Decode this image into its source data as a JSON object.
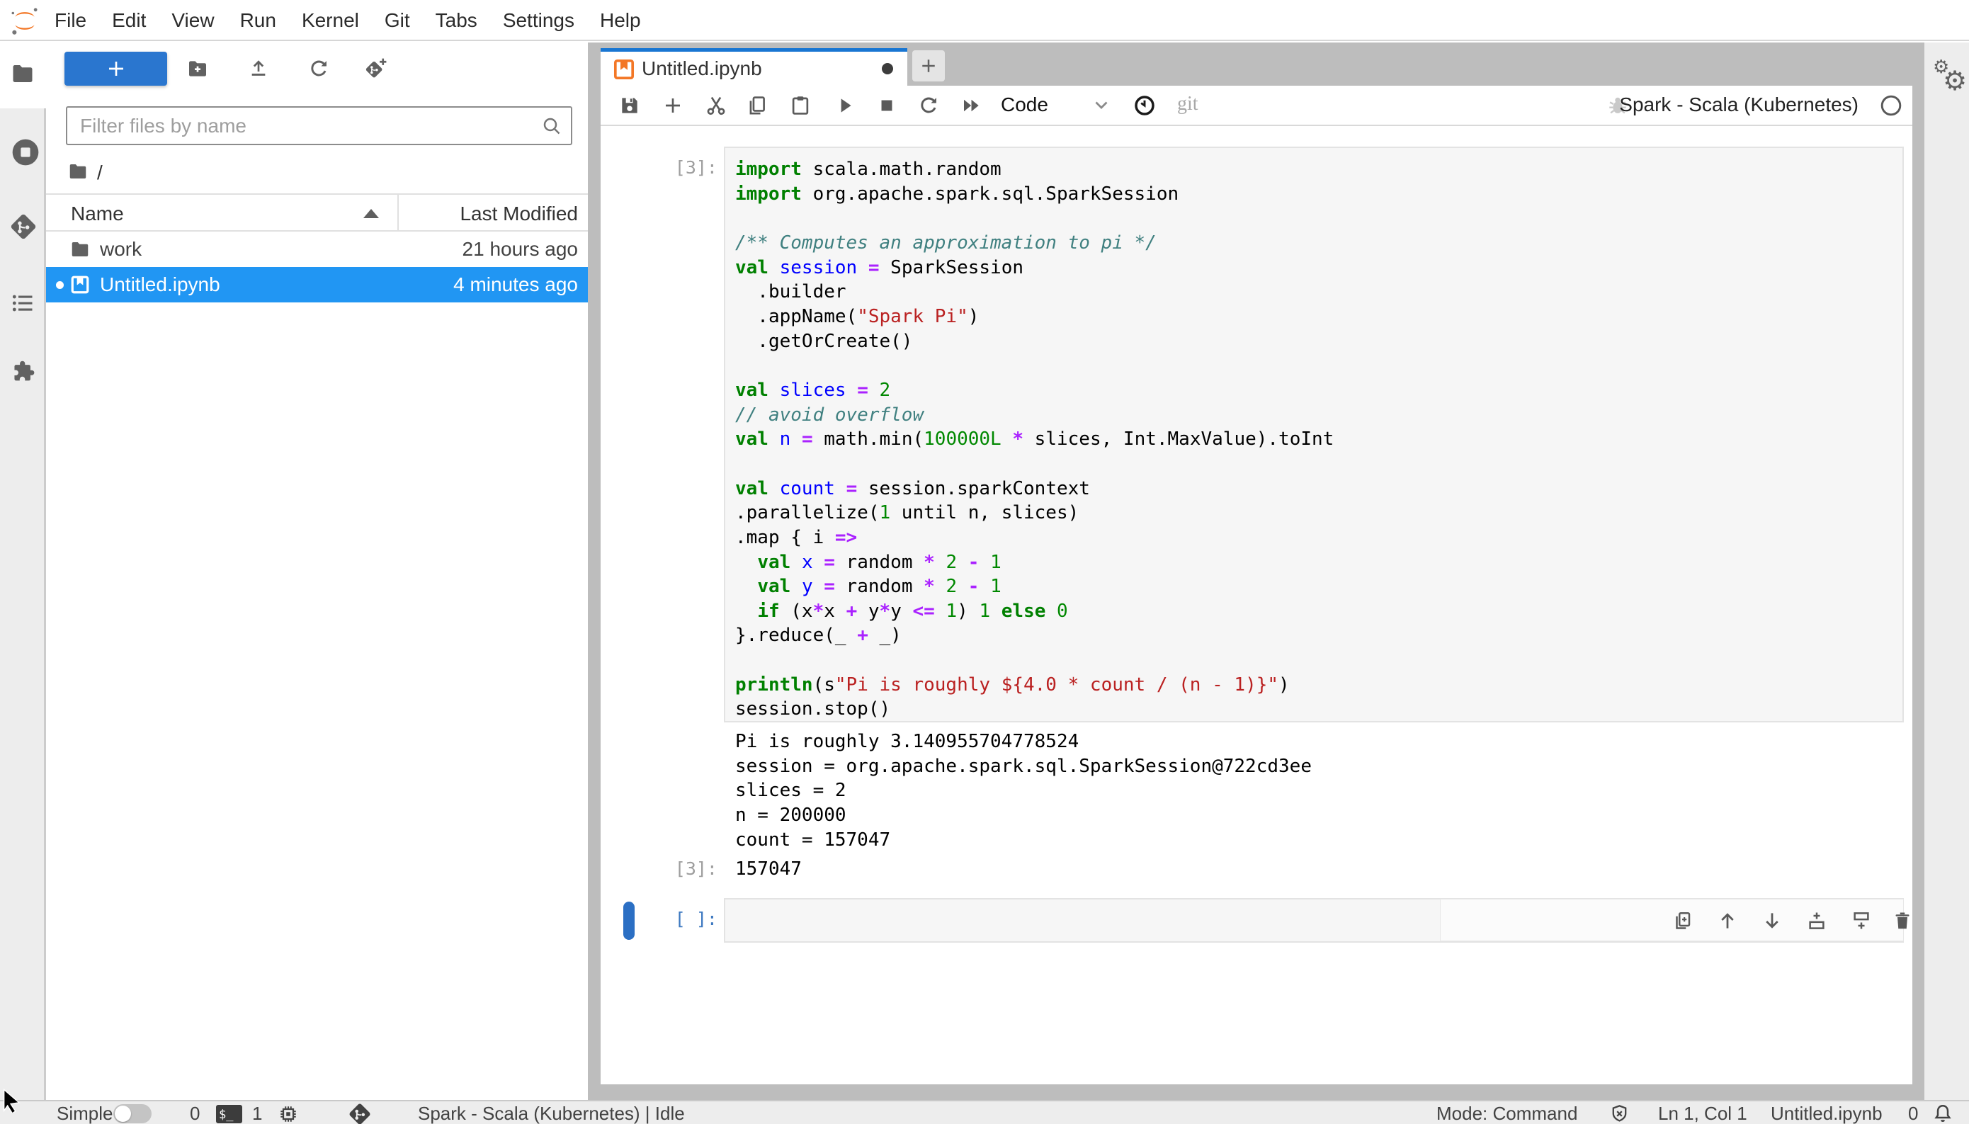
{
  "colors": {
    "accent": "#1976d2",
    "selection": "#2196f3",
    "launcher_button": "#2a76cf",
    "collapser": "#2b6fc4",
    "active_prompt": "#3d78c0",
    "keyword": "#008000",
    "definition": "#0000ff",
    "operator": "#AA22FF",
    "number": "#008800",
    "string": "#BA2121",
    "comment": "#408080",
    "brand_orange": "#F37726"
  },
  "menu": {
    "items": [
      "File",
      "Edit",
      "View",
      "Run",
      "Kernel",
      "Git",
      "Tabs",
      "Settings",
      "Help"
    ]
  },
  "left_sidebar": {
    "icons": [
      "folder-icon",
      "running-kernels-icon",
      "git-icon",
      "table-of-contents-icon",
      "extensions-icon"
    ]
  },
  "file_browser": {
    "new_launcher_label": "+",
    "toolbar_icons": [
      "new-folder-icon",
      "upload-icon",
      "refresh-icon",
      "git-clone-icon"
    ],
    "filter_placeholder": "Filter files by name",
    "breadcrumb_root": "/",
    "columns": {
      "name": "Name",
      "modified": "Last Modified"
    },
    "files": [
      {
        "icon": "folder-icon",
        "name": "work",
        "modified": "21 hours ago",
        "selected": false
      },
      {
        "icon": "notebook-icon",
        "name": "Untitled.ipynb",
        "modified": "4 minutes ago",
        "selected": true
      }
    ]
  },
  "main_tab": {
    "label": "Untitled.ipynb",
    "modified": true,
    "new_tab_label": "+"
  },
  "nb_toolbar": {
    "left_icons": [
      "save-icon",
      "add-cell-icon",
      "cut-icon",
      "copy-icon",
      "paste-icon",
      "run-icon",
      "stop-icon",
      "restart-icon",
      "run-all-icon"
    ],
    "cell_type": "Code",
    "git_label": "git",
    "kernel_name": "Spark - Scala (Kubernetes)",
    "right_icons": [
      "bug-icon",
      "kernel-status-circle-icon"
    ]
  },
  "notebook": {
    "cells": [
      {
        "prompt": "[3]:",
        "lines": [
          [
            [
              "k",
              "import"
            ],
            [
              "p",
              " scala.math.random"
            ]
          ],
          [
            [
              "k",
              "import"
            ],
            [
              "p",
              " org.apache.spark.sql.SparkSession"
            ]
          ],
          [],
          [
            [
              "c",
              "/** Computes an approximation to pi */"
            ]
          ],
          [
            [
              "k",
              "val"
            ],
            [
              "p",
              " "
            ],
            [
              "d",
              "session"
            ],
            [
              "p",
              " "
            ],
            [
              "o",
              "="
            ],
            [
              "p",
              " SparkSession"
            ]
          ],
          [
            [
              "p",
              "  .builder"
            ]
          ],
          [
            [
              "p",
              "  .appName("
            ],
            [
              "s",
              "\"Spark Pi\""
            ],
            [
              "p",
              ")"
            ]
          ],
          [
            [
              "p",
              "  .getOrCreate()"
            ]
          ],
          [],
          [
            [
              "k",
              "val"
            ],
            [
              "p",
              " "
            ],
            [
              "d",
              "slices"
            ],
            [
              "p",
              " "
            ],
            [
              "o",
              "="
            ],
            [
              "p",
              " "
            ],
            [
              "n",
              "2"
            ]
          ],
          [
            [
              "c",
              "// avoid overflow"
            ]
          ],
          [
            [
              "k",
              "val"
            ],
            [
              "p",
              " "
            ],
            [
              "d",
              "n"
            ],
            [
              "p",
              " "
            ],
            [
              "o",
              "="
            ],
            [
              "p",
              " math.min("
            ],
            [
              "n",
              "100000L"
            ],
            [
              "p",
              " "
            ],
            [
              "o",
              "*"
            ],
            [
              "p",
              " slices, Int.MaxValue).toInt"
            ]
          ],
          [],
          [
            [
              "k",
              "val"
            ],
            [
              "p",
              " "
            ],
            [
              "d",
              "count"
            ],
            [
              "p",
              " "
            ],
            [
              "o",
              "="
            ],
            [
              "p",
              " session.sparkContext"
            ]
          ],
          [
            [
              "p",
              ".parallelize("
            ],
            [
              "n",
              "1"
            ],
            [
              "p",
              " until n, slices)"
            ]
          ],
          [
            [
              "p",
              ".map { i "
            ],
            [
              "o",
              "=>"
            ]
          ],
          [
            [
              "p",
              "  "
            ],
            [
              "k",
              "val"
            ],
            [
              "p",
              " "
            ],
            [
              "d",
              "x"
            ],
            [
              "p",
              " "
            ],
            [
              "o",
              "="
            ],
            [
              "p",
              " random "
            ],
            [
              "o",
              "*"
            ],
            [
              "p",
              " "
            ],
            [
              "n",
              "2"
            ],
            [
              "p",
              " "
            ],
            [
              "o",
              "-"
            ],
            [
              "p",
              " "
            ],
            [
              "n",
              "1"
            ]
          ],
          [
            [
              "p",
              "  "
            ],
            [
              "k",
              "val"
            ],
            [
              "p",
              " "
            ],
            [
              "d",
              "y"
            ],
            [
              "p",
              " "
            ],
            [
              "o",
              "="
            ],
            [
              "p",
              " random "
            ],
            [
              "o",
              "*"
            ],
            [
              "p",
              " "
            ],
            [
              "n",
              "2"
            ],
            [
              "p",
              " "
            ],
            [
              "o",
              "-"
            ],
            [
              "p",
              " "
            ],
            [
              "n",
              "1"
            ]
          ],
          [
            [
              "p",
              "  "
            ],
            [
              "k",
              "if"
            ],
            [
              "p",
              " (x"
            ],
            [
              "o",
              "*"
            ],
            [
              "p",
              "x "
            ],
            [
              "o",
              "+"
            ],
            [
              "p",
              " y"
            ],
            [
              "o",
              "*"
            ],
            [
              "p",
              "y "
            ],
            [
              "o",
              "<="
            ],
            [
              "p",
              " "
            ],
            [
              "n",
              "1"
            ],
            [
              "p",
              ") "
            ],
            [
              "n",
              "1"
            ],
            [
              "p",
              " "
            ],
            [
              "k",
              "else"
            ],
            [
              "p",
              " "
            ],
            [
              "n",
              "0"
            ]
          ],
          [
            [
              "p",
              "}.reduce(_ "
            ],
            [
              "o",
              "+"
            ],
            [
              "p",
              " _)"
            ]
          ],
          [],
          [
            [
              "b",
              "println"
            ],
            [
              "p",
              "(s"
            ],
            [
              "s",
              "\"Pi is roughly ${4.0 * count / (n - 1)}\""
            ],
            [
              "p",
              ")"
            ]
          ],
          [
            [
              "p",
              "session.stop()"
            ]
          ]
        ],
        "outputs": [
          "Pi is roughly 3.140955704778524",
          "session = org.apache.spark.sql.SparkSession@722cd3ee",
          "slices = 2",
          "n = 200000",
          "count = 157047"
        ],
        "result_prompt": "[3]:",
        "result": "157047"
      },
      {
        "prompt": "[ ]:",
        "toolbar_icons": [
          "duplicate-cell-icon",
          "move-cell-up-icon",
          "move-cell-down-icon",
          "insert-cell-above-icon",
          "insert-cell-below-icon",
          "delete-cell-icon"
        ]
      }
    ]
  },
  "right_sidebar": {
    "icons": [
      "property-inspector-gears-icon"
    ]
  },
  "status_bar": {
    "simple_label": "Simple",
    "terminals_count": "0",
    "terminal_badge": "$_",
    "kernels_count": "1",
    "kernel_status": "Spark - Scala (Kubernetes) | Idle",
    "mode": "Mode: Command",
    "cursor_position": "Ln 1, Col 1",
    "filename": "Untitled.ipynb",
    "notifications_count": "0"
  }
}
